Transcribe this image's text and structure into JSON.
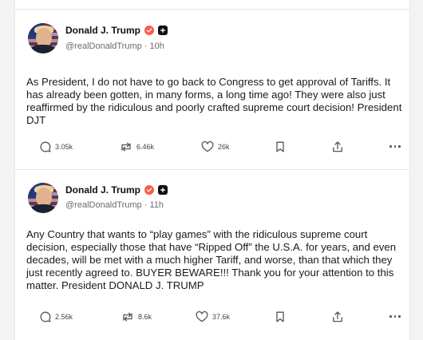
{
  "posts": [
    {
      "author": "Donald J. Trump",
      "handle_time": "@realDonaldTrump · 10h",
      "text": "As President, I do not have to go back to Congress to get approval of Tariffs. It has already been gotten, in many forms, a long time ago! They were also just reaffirmed by the ridiculous and poorly crafted supreme court decision! President DJT",
      "replies": "3.05k",
      "retruths": "6.46k",
      "likes": "26k"
    },
    {
      "author": "Donald J. Trump",
      "handle_time": "@realDonaldTrump · 11h",
      "text": "Any Country that wants to “play games” with the ridiculous supreme court decision, especially those that have “Ripped Off” the U.S.A. for years, and even decades, will be met with a much higher Tariff, and worse, than that which they just recently agreed to. BUYER BEWARE!!! Thank you for your attention to this matter. President DONALD J. TRUMP",
      "replies": "2.56k",
      "retruths": "8.6k",
      "likes": "37.6k"
    }
  ],
  "icons": {
    "verified": "verified-check-icon",
    "badge": "plus-badge-icon",
    "reply": "chat-bubble-icon",
    "retruth": "repost-arrows-icon",
    "like": "heart-icon",
    "bookmark": "bookmark-icon",
    "share": "share-upload-icon",
    "more": "ellipsis-icon"
  },
  "colors": {
    "verified": "#ff5b4a",
    "text": "#1a1a1a",
    "muted": "#6b6b6b",
    "divider": "#e5e5e5"
  }
}
